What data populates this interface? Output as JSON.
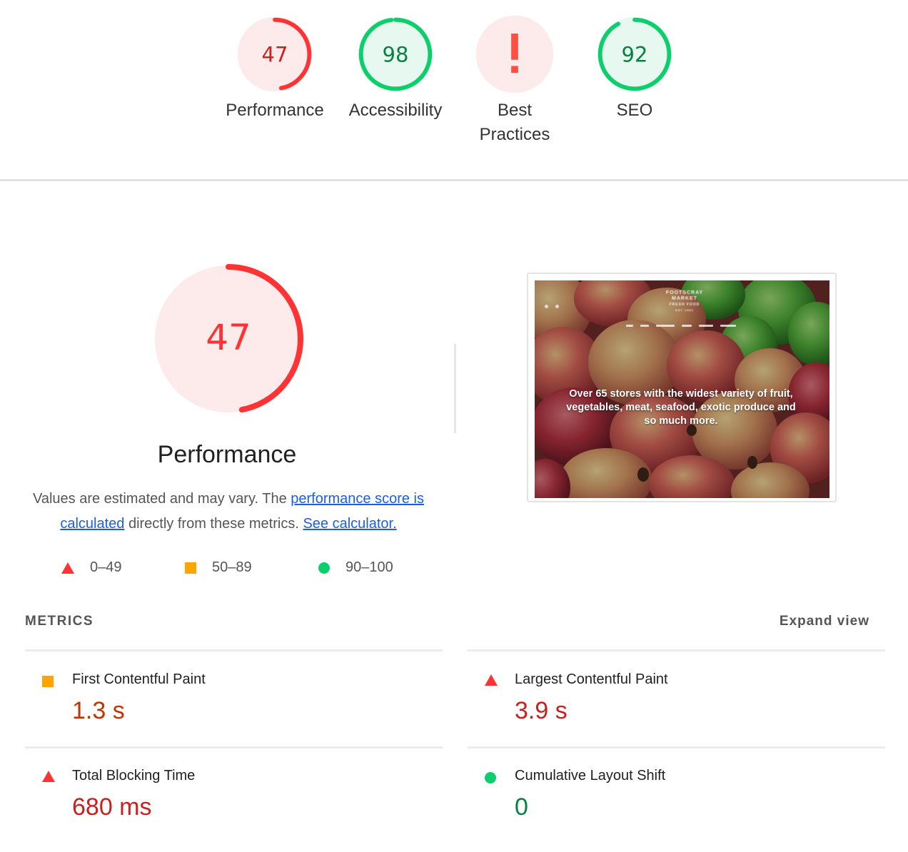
{
  "colors": {
    "fail": "#ff3333",
    "fail_text": "#c7221f",
    "fail_bg": "#fdeaea",
    "average": "#ffa400",
    "average_text": "#c33300",
    "pass": "#0cce6b",
    "pass_text": "#0b8043",
    "pass_bg": "#e6f8ef",
    "link": "#1a5fe0"
  },
  "categories": [
    {
      "id": "performance",
      "label": "Performance",
      "score": 47,
      "display": "47",
      "rating": "fail"
    },
    {
      "id": "accessibility",
      "label": "Accessibility",
      "score": 98,
      "display": "98",
      "rating": "pass"
    },
    {
      "id": "best-practices",
      "label_line1": "Best",
      "label_line2": "Practices",
      "score": null,
      "display": "!",
      "rating": "error"
    },
    {
      "id": "seo",
      "label": "SEO",
      "score": 92,
      "display": "92",
      "rating": "pass"
    }
  ],
  "performance": {
    "score": 47,
    "display": "47",
    "title": "Performance",
    "description_prefix": "Values are estimated and may vary. The ",
    "description_link1": "performance score is calculated",
    "description_middle": " directly from these metrics. ",
    "description_link2": "See calculator."
  },
  "legend": [
    {
      "shape": "triangle",
      "range": "0–49"
    },
    {
      "shape": "square",
      "range": "50–89"
    },
    {
      "shape": "circle",
      "range": "90–100"
    }
  ],
  "screenshot": {
    "logo_lines": [
      "FOOTSCRAY",
      "MARKET",
      "FRESH FOOD",
      "EST 1981"
    ],
    "headline": "Over 65 stores with the widest variety of fruit, vegetables, meat, seafood, exotic produce and so much more."
  },
  "metrics": {
    "header": "METRICS",
    "expand_label": "Expand view",
    "items": [
      {
        "label": "First Contentful Paint",
        "value": "1.3 s",
        "rating": "average"
      },
      {
        "label": "Largest Contentful Paint",
        "value": "3.9 s",
        "rating": "fail"
      },
      {
        "label": "Total Blocking Time",
        "value": "680 ms",
        "rating": "fail"
      },
      {
        "label": "Cumulative Layout Shift",
        "value": "0",
        "rating": "pass"
      }
    ]
  }
}
